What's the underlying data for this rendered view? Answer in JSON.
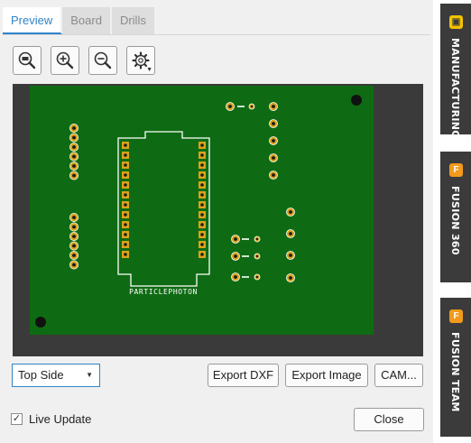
{
  "tabs": [
    {
      "label": "Preview",
      "active": true
    },
    {
      "label": "Board",
      "active": false
    },
    {
      "label": "Drills",
      "active": false
    }
  ],
  "toolbar": {
    "icons": [
      "zoom-fit-icon",
      "zoom-in-icon",
      "zoom-out-icon",
      "settings-icon"
    ]
  },
  "preview": {
    "silkscreen_label": "PARTICLEPHOTON",
    "board_color": "#0f6b13",
    "pad_color": "#d9a21b",
    "background_color": "#3a3a3a"
  },
  "side_select": {
    "value": "Top Side"
  },
  "buttons": {
    "export_dxf": "Export DXF",
    "export_image": "Export Image",
    "cam": "CAM...",
    "close": "Close"
  },
  "live_update": {
    "label": "Live Update",
    "checked": true
  },
  "side_panel": {
    "tabs": [
      {
        "label": "MANUFACTURING",
        "badge_color": "#f2c200"
      },
      {
        "label": "FUSION 360",
        "badge_color": "#f29a1b"
      },
      {
        "label": "FUSION TEAM",
        "badge_color": "#f29a1b"
      }
    ]
  }
}
